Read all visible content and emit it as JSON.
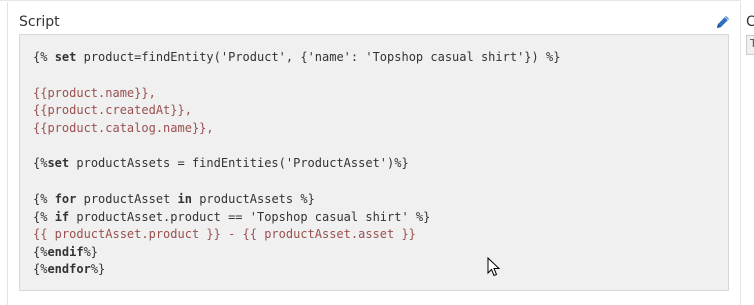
{
  "panel": {
    "title": "Script"
  },
  "right_panel": {
    "title_fragment": "C",
    "field_fragment": "T"
  },
  "code": {
    "line1": {
      "open": "{% ",
      "kw": "set",
      "mid": " product=findEntity('Product', {'name': 'Topshop casual shirt'}) %}"
    },
    "line2": "{{product.name}},",
    "line3": "{{product.createdAt}},",
    "line4": "{{product.catalog.name}},",
    "line5": {
      "open": "{%",
      "kw": "set",
      "mid": " productAssets = findEntities('ProductAsset')%}"
    },
    "line6": {
      "open": "{% ",
      "kw1": "for",
      "mid1": " productAsset ",
      "kw2": "in",
      "mid2": " productAssets %}"
    },
    "line7": {
      "open": "{% ",
      "kw": "if",
      "mid": " productAsset.product == 'Topshop casual shirt' %}"
    },
    "line8": "{{ productAsset.product }} - {{ productAsset.asset }}",
    "line9": {
      "open": "{%",
      "kw": "endif",
      "close": "%}"
    },
    "line10": {
      "open": "{%",
      "kw": "endfor",
      "close": "%}"
    }
  },
  "icons": {
    "edit": "pencil-icon",
    "cursor": "mouse-pointer-icon"
  },
  "colors": {
    "code_bg": "#f0f0f0",
    "expression": "#9a5050",
    "edit_icon": "#2f6fbf"
  }
}
